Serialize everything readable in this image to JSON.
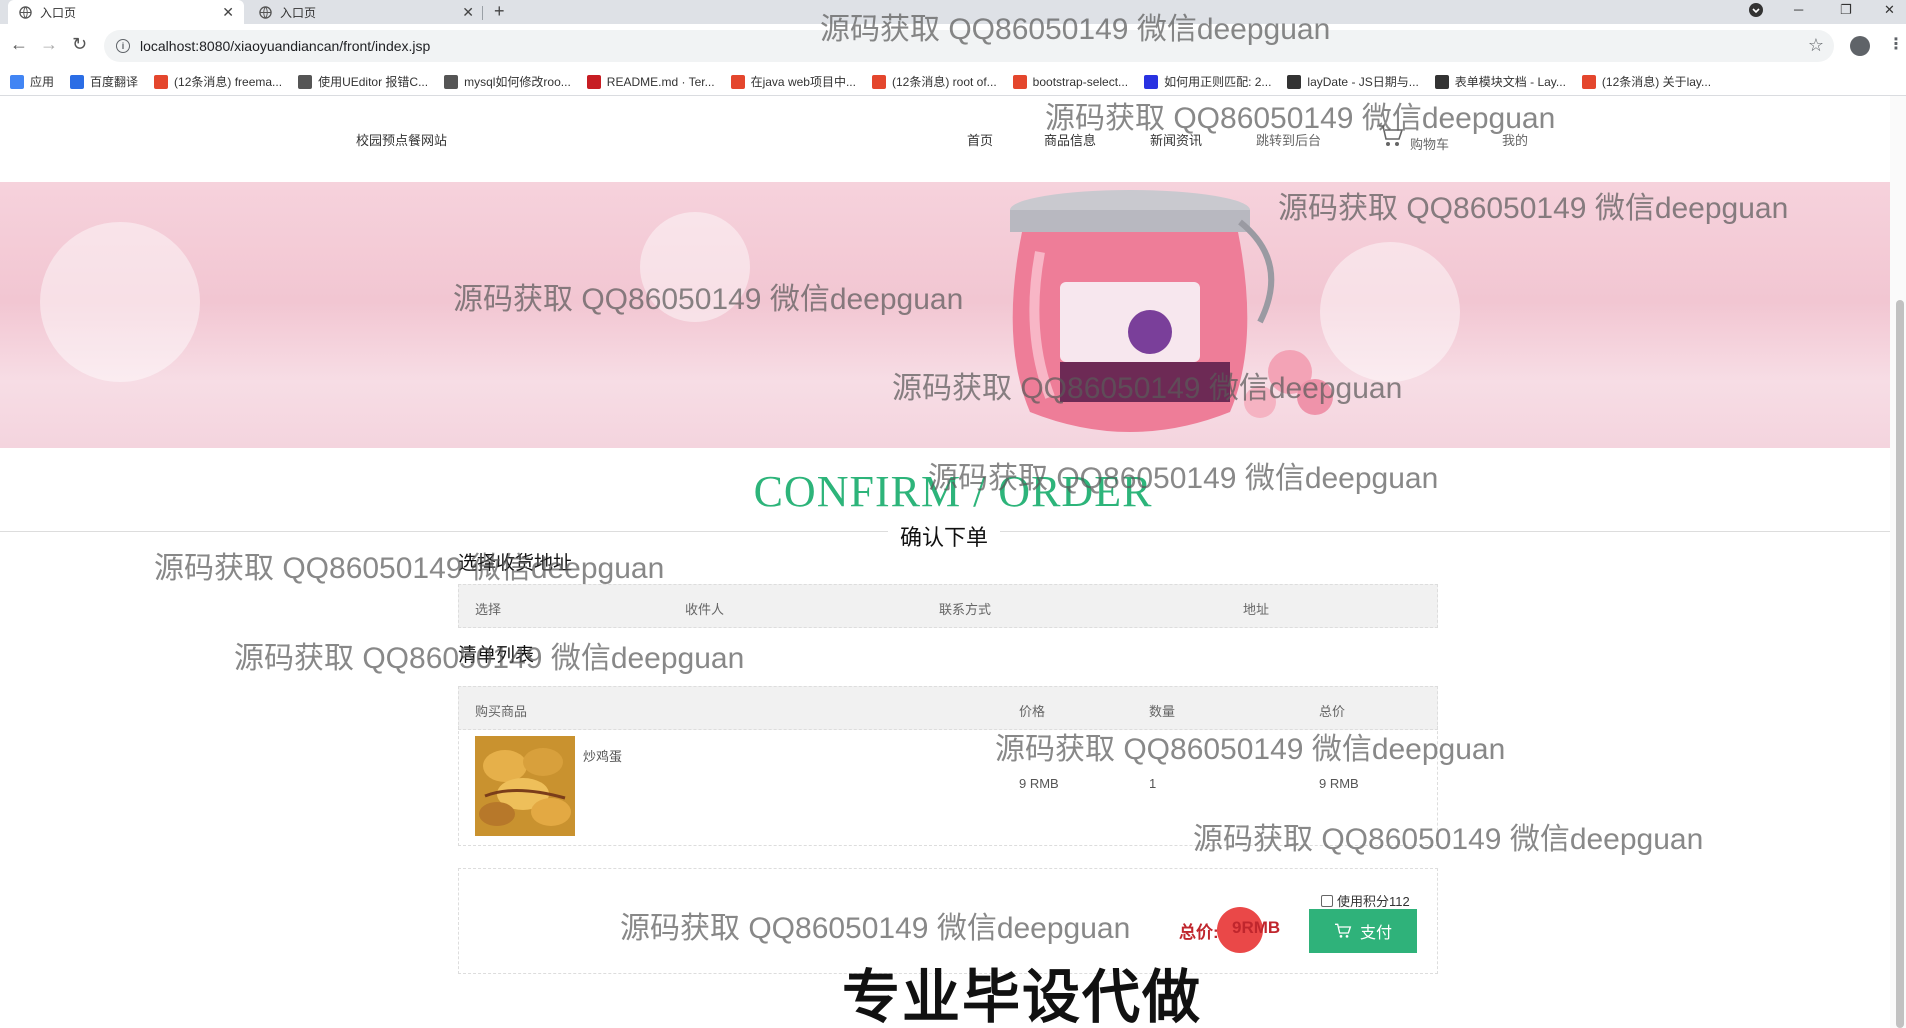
{
  "browser": {
    "tabs": [
      {
        "title": "入口页",
        "active": true
      },
      {
        "title": "入口页",
        "active": false
      }
    ],
    "url": "localhost:8080/xiaoyuandiancan/front/index.jsp",
    "bookmarks": [
      {
        "label": "应用",
        "color": "#4285f4"
      },
      {
        "label": "百度翻译",
        "color": "#2b6de5"
      },
      {
        "label": "(12条消息) freema...",
        "color": "#e4462d"
      },
      {
        "label": "使用UEditor 报错C...",
        "color": "#555555"
      },
      {
        "label": "mysql如何修改roo...",
        "color": "#555555"
      },
      {
        "label": "README.md · Ter...",
        "color": "#c71d23"
      },
      {
        "label": "在java web项目中...",
        "color": "#e4462d"
      },
      {
        "label": "(12条消息) root of...",
        "color": "#e4462d"
      },
      {
        "label": "bootstrap-select...",
        "color": "#e4462d"
      },
      {
        "label": "如何用正则匹配: 2...",
        "color": "#2932e1"
      },
      {
        "label": "layDate - JS日期与...",
        "color": "#333333"
      },
      {
        "label": "表单模块文档 - Lay...",
        "color": "#333333"
      },
      {
        "label": "(12条消息) 关于lay...",
        "color": "#e4462d"
      }
    ]
  },
  "site": {
    "title": "校园预点餐网站",
    "nav": {
      "home": "首页",
      "products": "商品信息",
      "news": "新闻资讯",
      "admin": "跳转到后台",
      "cart": "购物车",
      "mine": "我的"
    }
  },
  "order": {
    "title_en": "CONFIRM / ORDER",
    "title_cn": "确认下单",
    "address_section": "选择收货地址",
    "address_headers": {
      "select": "选择",
      "receiver": "收件人",
      "contact": "联系方式",
      "address": "地址"
    },
    "list_section": "清单列表",
    "list_headers": {
      "product": "购买商品",
      "price": "价格",
      "quantity": "数量",
      "total": "总价"
    },
    "items": [
      {
        "name": "炒鸡蛋",
        "price": "9 RMB",
        "quantity": "1",
        "total": "9 RMB"
      }
    ],
    "use_points_label": "使用积分112",
    "use_points_checked": false,
    "total_label": "总价:",
    "total_amount": "9RMB",
    "pay_label": "支付"
  },
  "watermarks": {
    "text": "源码获取 QQ86050149 微信deepguan",
    "promo": "专业毕设代做"
  },
  "colors": {
    "accent_green": "#2fb27a",
    "title_green": "#2db47a",
    "price_red": "#c0262d",
    "banner_pink": "#f2c6d2"
  }
}
